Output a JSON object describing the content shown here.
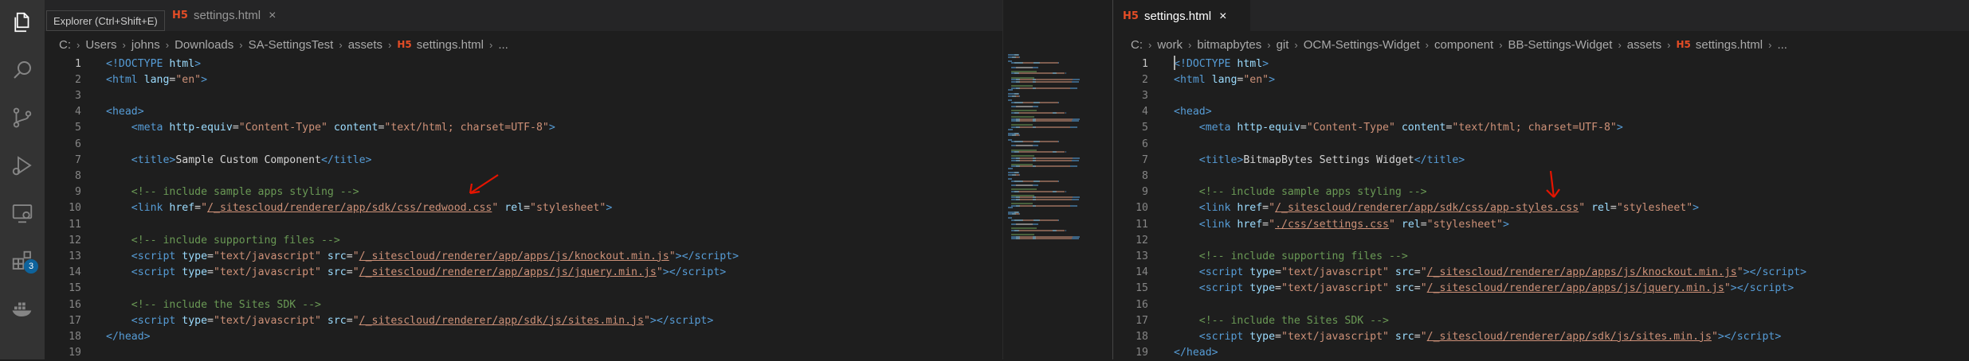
{
  "tooltip": "Explorer (Ctrl+Shift+E)",
  "activity_bar": {
    "items": [
      {
        "name": "explorer-icon"
      },
      {
        "name": "search-icon"
      },
      {
        "name": "source-control-icon"
      },
      {
        "name": "run-debug-icon"
      },
      {
        "name": "remote-explorer-icon"
      },
      {
        "name": "extensions-icon",
        "badge": "3"
      },
      {
        "name": "docker-icon"
      }
    ]
  },
  "left_editor": {
    "tab": {
      "label": "settings.html",
      "icon": "H5",
      "close": "×"
    },
    "more_actions": "···",
    "breadcrumb": [
      "C:",
      "Users",
      "johns",
      "Downloads",
      "SA-SettingsTest",
      "assets",
      "settings.html",
      "..."
    ],
    "breadcrumb_file_icon": "H5",
    "lines": [
      {
        "n": "1",
        "t": [
          [
            "&lt;!",
            "tg"
          ],
          [
            "DOCTYPE",
            "tg"
          ],
          [
            " html",
            "at"
          ],
          [
            "&gt;",
            "tg"
          ]
        ]
      },
      {
        "n": "2",
        "t": [
          [
            "&lt;html",
            "tg"
          ],
          [
            " lang",
            "at"
          ],
          [
            "=",
            "pl"
          ],
          [
            "\"en\"",
            "st"
          ],
          [
            "&gt;",
            "tg"
          ]
        ]
      },
      {
        "n": "3",
        "t": []
      },
      {
        "n": "4",
        "t": [
          [
            "&lt;head&gt;",
            "tg"
          ]
        ]
      },
      {
        "n": "5",
        "t": [
          [
            "    ",
            "pl"
          ],
          [
            "&lt;meta",
            "tg"
          ],
          [
            " http-equiv",
            "at"
          ],
          [
            "=",
            "pl"
          ],
          [
            "\"Content-Type\"",
            "st"
          ],
          [
            " content",
            "at"
          ],
          [
            "=",
            "pl"
          ],
          [
            "\"text/html; charset=UTF-8\"",
            "st"
          ],
          [
            "&gt;",
            "tg"
          ]
        ]
      },
      {
        "n": "6",
        "t": []
      },
      {
        "n": "7",
        "t": [
          [
            "    ",
            "pl"
          ],
          [
            "&lt;title&gt;",
            "tg"
          ],
          [
            "Sample Custom Component",
            "tx"
          ],
          [
            "&lt;/title&gt;",
            "tg"
          ]
        ]
      },
      {
        "n": "8",
        "t": []
      },
      {
        "n": "9",
        "t": [
          [
            "    ",
            "pl"
          ],
          [
            "&lt;!-- include sample apps styling --&gt;",
            "cm"
          ]
        ]
      },
      {
        "n": "10",
        "t": [
          [
            "    ",
            "pl"
          ],
          [
            "&lt;link",
            "tg"
          ],
          [
            " href",
            "at"
          ],
          [
            "=",
            "pl"
          ],
          [
            "\"",
            "st"
          ],
          [
            "/_sitescloud/renderer/app/sdk/css/redwood.css",
            "st ul"
          ],
          [
            "\"",
            "st"
          ],
          [
            " rel",
            "at"
          ],
          [
            "=",
            "pl"
          ],
          [
            "\"stylesheet\"",
            "st"
          ],
          [
            "&gt;",
            "tg"
          ]
        ]
      },
      {
        "n": "11",
        "t": []
      },
      {
        "n": "12",
        "t": [
          [
            "    ",
            "pl"
          ],
          [
            "&lt;!-- include supporting files --&gt;",
            "cm"
          ]
        ]
      },
      {
        "n": "13",
        "t": [
          [
            "    ",
            "pl"
          ],
          [
            "&lt;script",
            "tg"
          ],
          [
            " type",
            "at"
          ],
          [
            "=",
            "pl"
          ],
          [
            "\"text/javascript\"",
            "st"
          ],
          [
            " src",
            "at"
          ],
          [
            "=",
            "pl"
          ],
          [
            "\"",
            "st"
          ],
          [
            "/_sitescloud/renderer/app/apps/js/knockout.min.js",
            "st ul"
          ],
          [
            "\"",
            "st"
          ],
          [
            "&gt;&lt;/script&gt;",
            "tg"
          ]
        ]
      },
      {
        "n": "14",
        "t": [
          [
            "    ",
            "pl"
          ],
          [
            "&lt;script",
            "tg"
          ],
          [
            " type",
            "at"
          ],
          [
            "=",
            "pl"
          ],
          [
            "\"text/javascript\"",
            "st"
          ],
          [
            " src",
            "at"
          ],
          [
            "=",
            "pl"
          ],
          [
            "\"",
            "st"
          ],
          [
            "/_sitescloud/renderer/app/apps/js/jquery.min.js",
            "st ul"
          ],
          [
            "\"",
            "st"
          ],
          [
            "&gt;&lt;/script&gt;",
            "tg"
          ]
        ]
      },
      {
        "n": "15",
        "t": []
      },
      {
        "n": "16",
        "t": [
          [
            "    ",
            "pl"
          ],
          [
            "&lt;!-- include the Sites SDK --&gt;",
            "cm"
          ]
        ]
      },
      {
        "n": "17",
        "t": [
          [
            "    ",
            "pl"
          ],
          [
            "&lt;script",
            "tg"
          ],
          [
            " type",
            "at"
          ],
          [
            "=",
            "pl"
          ],
          [
            "\"text/javascript\"",
            "st"
          ],
          [
            " src",
            "at"
          ],
          [
            "=",
            "pl"
          ],
          [
            "\"",
            "st"
          ],
          [
            "/_sitescloud/renderer/app/sdk/js/sites.min.js",
            "st ul"
          ],
          [
            "\"",
            "st"
          ],
          [
            "&gt;&lt;/script&gt;",
            "tg"
          ]
        ]
      },
      {
        "n": "18",
        "t": [
          [
            "&lt;/head&gt;",
            "tg"
          ]
        ]
      },
      {
        "n": "19",
        "t": []
      }
    ]
  },
  "right_editor": {
    "tab": {
      "label": "settings.html",
      "icon": "H5",
      "close": "×"
    },
    "breadcrumb": [
      "C:",
      "work",
      "bitmapbytes",
      "git",
      "OCM-Settings-Widget",
      "component",
      "BB-Settings-Widget",
      "assets",
      "settings.html",
      "..."
    ],
    "breadcrumb_file_icon": "H5",
    "lines": [
      {
        "n": "1",
        "t": [
          [
            "&lt;!",
            "tg"
          ],
          [
            "DOCTYPE",
            "tg"
          ],
          [
            " html",
            "at"
          ],
          [
            "&gt;",
            "tg"
          ]
        ]
      },
      {
        "n": "2",
        "t": [
          [
            "&lt;html",
            "tg"
          ],
          [
            " lang",
            "at"
          ],
          [
            "=",
            "pl"
          ],
          [
            "\"en\"",
            "st"
          ],
          [
            "&gt;",
            "tg"
          ]
        ]
      },
      {
        "n": "3",
        "t": []
      },
      {
        "n": "4",
        "t": [
          [
            "&lt;head&gt;",
            "tg"
          ]
        ]
      },
      {
        "n": "5",
        "t": [
          [
            "    ",
            "pl"
          ],
          [
            "&lt;meta",
            "tg"
          ],
          [
            " http-equiv",
            "at"
          ],
          [
            "=",
            "pl"
          ],
          [
            "\"Content-Type\"",
            "st"
          ],
          [
            " content",
            "at"
          ],
          [
            "=",
            "pl"
          ],
          [
            "\"text/html; charset=UTF-8\"",
            "st"
          ],
          [
            "&gt;",
            "tg"
          ]
        ]
      },
      {
        "n": "6",
        "t": []
      },
      {
        "n": "7",
        "t": [
          [
            "    ",
            "pl"
          ],
          [
            "&lt;title&gt;",
            "tg"
          ],
          [
            "BitmapBytes Settings Widget",
            "tx"
          ],
          [
            "&lt;/title&gt;",
            "tg"
          ]
        ]
      },
      {
        "n": "8",
        "t": []
      },
      {
        "n": "9",
        "t": [
          [
            "    ",
            "pl"
          ],
          [
            "&lt;!-- include sample apps styling --&gt;",
            "cm"
          ]
        ]
      },
      {
        "n": "10",
        "t": [
          [
            "    ",
            "pl"
          ],
          [
            "&lt;link",
            "tg"
          ],
          [
            " href",
            "at"
          ],
          [
            "=",
            "pl"
          ],
          [
            "\"",
            "st"
          ],
          [
            "/_sitescloud/renderer/app/sdk/css/app-styles.css",
            "st ul"
          ],
          [
            "\"",
            "st"
          ],
          [
            " rel",
            "at"
          ],
          [
            "=",
            "pl"
          ],
          [
            "\"stylesheet\"",
            "st"
          ],
          [
            "&gt;",
            "tg"
          ]
        ]
      },
      {
        "n": "11",
        "t": [
          [
            "    ",
            "pl"
          ],
          [
            "&lt;link",
            "tg"
          ],
          [
            " href",
            "at"
          ],
          [
            "=",
            "pl"
          ],
          [
            "\"",
            "st"
          ],
          [
            "./css/settings.css",
            "st ul"
          ],
          [
            "\"",
            "st"
          ],
          [
            " rel",
            "at"
          ],
          [
            "=",
            "pl"
          ],
          [
            "\"stylesheet\"",
            "st"
          ],
          [
            "&gt;",
            "tg"
          ]
        ]
      },
      {
        "n": "12",
        "t": []
      },
      {
        "n": "13",
        "t": [
          [
            "    ",
            "pl"
          ],
          [
            "&lt;!-- include supporting files --&gt;",
            "cm"
          ]
        ]
      },
      {
        "n": "14",
        "t": [
          [
            "    ",
            "pl"
          ],
          [
            "&lt;script",
            "tg"
          ],
          [
            " type",
            "at"
          ],
          [
            "=",
            "pl"
          ],
          [
            "\"text/javascript\"",
            "st"
          ],
          [
            " src",
            "at"
          ],
          [
            "=",
            "pl"
          ],
          [
            "\"",
            "st"
          ],
          [
            "/_sitescloud/renderer/app/apps/js/knockout.min.js",
            "st ul"
          ],
          [
            "\"",
            "st"
          ],
          [
            "&gt;&lt;/script&gt;",
            "tg"
          ]
        ]
      },
      {
        "n": "15",
        "t": [
          [
            "    ",
            "pl"
          ],
          [
            "&lt;script",
            "tg"
          ],
          [
            " type",
            "at"
          ],
          [
            "=",
            "pl"
          ],
          [
            "\"text/javascript\"",
            "st"
          ],
          [
            " src",
            "at"
          ],
          [
            "=",
            "pl"
          ],
          [
            "\"",
            "st"
          ],
          [
            "/_sitescloud/renderer/app/apps/js/jquery.min.js",
            "st ul"
          ],
          [
            "\"",
            "st"
          ],
          [
            "&gt;&lt;/script&gt;",
            "tg"
          ]
        ]
      },
      {
        "n": "16",
        "t": []
      },
      {
        "n": "17",
        "t": [
          [
            "    ",
            "pl"
          ],
          [
            "&lt;!-- include the Sites SDK --&gt;",
            "cm"
          ]
        ]
      },
      {
        "n": "18",
        "t": [
          [
            "    ",
            "pl"
          ],
          [
            "&lt;script",
            "tg"
          ],
          [
            " type",
            "at"
          ],
          [
            "=",
            "pl"
          ],
          [
            "\"text/javascript\"",
            "st"
          ],
          [
            " src",
            "at"
          ],
          [
            "=",
            "pl"
          ],
          [
            "\"",
            "st"
          ],
          [
            "/_sitescloud/renderer/app/sdk/js/sites.min.js",
            "st ul"
          ],
          [
            "\"",
            "st"
          ],
          [
            "&gt;&lt;/script&gt;",
            "tg"
          ]
        ]
      },
      {
        "n": "19",
        "t": [
          [
            "&lt;/head&gt;",
            "tg"
          ]
        ]
      }
    ]
  },
  "colors": {
    "annotation_arrow": "#e51400",
    "activity_bar": "#333333",
    "editor_bg": "#1e1e1e"
  }
}
